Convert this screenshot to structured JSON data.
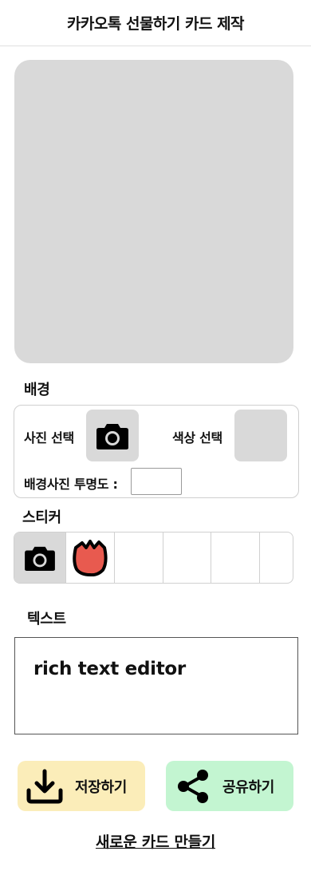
{
  "header": {
    "title": "카카오톡 선물하기 카드 제작"
  },
  "background_section": {
    "title": "배경",
    "photo_label": "사진 선택",
    "color_label": "색상 선택",
    "opacity_label": "배경사진 투명도 :",
    "opacity_value": ""
  },
  "sticker_section": {
    "title": "스티커",
    "stickers": [
      "camera-icon",
      "tulip-sticker",
      "",
      "",
      "",
      ""
    ]
  },
  "text_section": {
    "title": "텍스트",
    "editor_text": "rich text editor"
  },
  "actions": {
    "save_label": "저장하기",
    "share_label": "공유하기",
    "new_card_label": "새로운 카드 만들기"
  },
  "colors": {
    "preview_bg": "#d9d9d9",
    "save_bg": "#fbedb9",
    "share_bg": "#c3f5d1",
    "tulip": "#e85a4f"
  }
}
